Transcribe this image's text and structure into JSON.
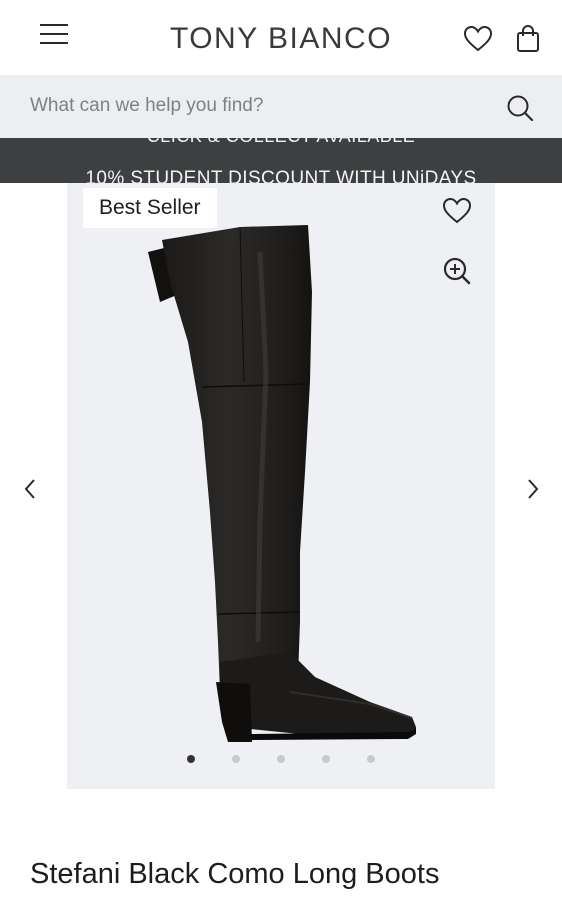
{
  "header": {
    "logo": "TONY BIANCO"
  },
  "search": {
    "placeholder": "What can we help you find?"
  },
  "promo": {
    "previous_message": "CLICK & COLLECT AVAILABLE",
    "current_message": "10% STUDENT DISCOUNT WITH UNiDAYS"
  },
  "product": {
    "badge": "Best Seller",
    "title": "Stefani Black Como Long Boots",
    "image_count": 5,
    "active_image": 1
  },
  "colors": {
    "promo_bg": "#3d3f41",
    "search_bg": "#eceef1",
    "gallery_bg": "#eef0f3"
  }
}
